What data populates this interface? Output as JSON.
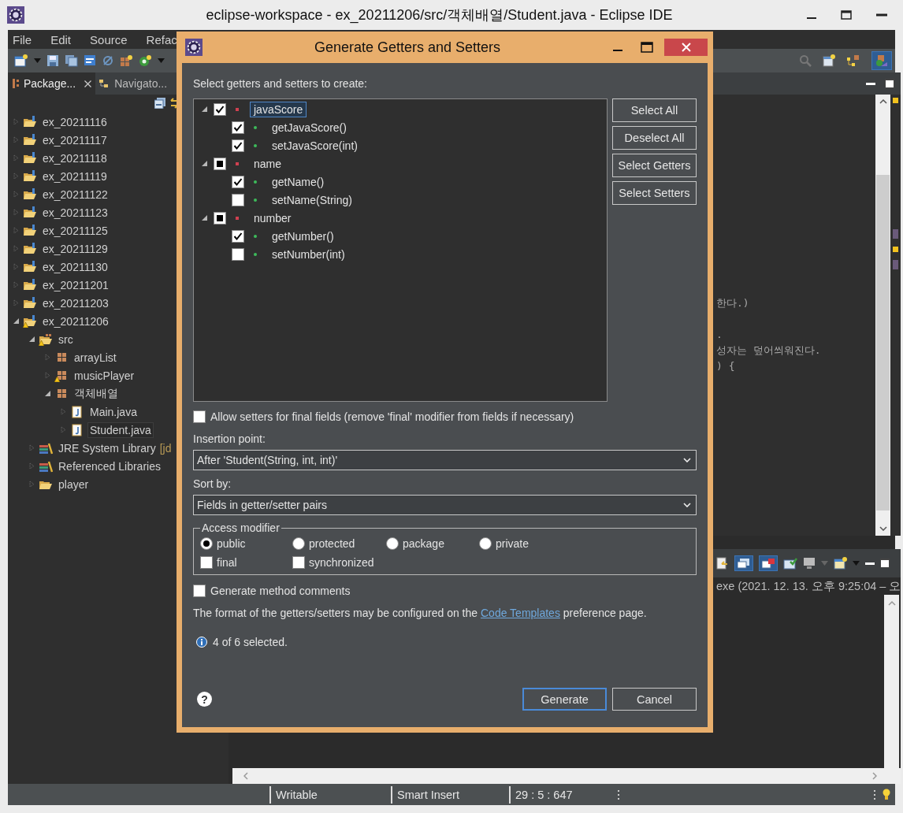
{
  "window": {
    "title": "eclipse-workspace - ex_20211206/src/객체배열/Student.java - Eclipse IDE"
  },
  "menu": [
    "File",
    "Edit",
    "Source",
    "Refac"
  ],
  "explorer": {
    "tabs": [
      {
        "label": "Package...",
        "selected": true
      },
      {
        "label": "Navigato...",
        "selected": false
      }
    ],
    "tree": [
      {
        "label": "ex_20211116",
        "kind": "project",
        "expanded": false,
        "warning": false,
        "selected": false
      },
      {
        "label": "ex_20211117",
        "kind": "project",
        "expanded": false,
        "warning": false,
        "selected": false
      },
      {
        "label": "ex_20211118",
        "kind": "project",
        "expanded": false,
        "warning": false,
        "selected": false
      },
      {
        "label": "ex_20211119",
        "kind": "project",
        "expanded": false,
        "warning": false,
        "selected": false
      },
      {
        "label": "ex_20211122",
        "kind": "project",
        "expanded": false,
        "warning": false,
        "selected": false
      },
      {
        "label": "ex_20211123",
        "kind": "project",
        "expanded": false,
        "warning": false,
        "selected": false
      },
      {
        "label": "ex_20211125",
        "kind": "project",
        "expanded": false,
        "warning": false,
        "selected": false
      },
      {
        "label": "ex_20211129",
        "kind": "project",
        "expanded": false,
        "warning": false,
        "selected": false
      },
      {
        "label": "ex_20211130",
        "kind": "project",
        "expanded": false,
        "warning": false,
        "selected": false
      },
      {
        "label": "ex_20211201",
        "kind": "project",
        "expanded": false,
        "warning": false,
        "selected": false
      },
      {
        "label": "ex_20211203",
        "kind": "project",
        "expanded": false,
        "warning": false,
        "selected": false
      },
      {
        "label": "ex_20211206",
        "kind": "project",
        "expanded": true,
        "warning": true,
        "selected": false,
        "children": [
          {
            "label": "src",
            "kind": "source-folder",
            "expanded": true,
            "warning": true,
            "selected": false,
            "children": [
              {
                "label": "arrayList",
                "kind": "package",
                "expanded": false,
                "warning": false,
                "selected": false
              },
              {
                "label": "musicPlayer",
                "kind": "package",
                "expanded": false,
                "warning": true,
                "selected": false
              },
              {
                "label": "객체배열",
                "kind": "package",
                "expanded": true,
                "warning": false,
                "selected": false,
                "children": [
                  {
                    "label": "Main.java",
                    "kind": "java-file",
                    "expanded": false,
                    "warning": false,
                    "selected": false
                  },
                  {
                    "label": "Student.java",
                    "kind": "java-file",
                    "expanded": false,
                    "warning": false,
                    "selected": true
                  }
                ]
              }
            ]
          },
          {
            "label": "JRE System Library",
            "decoration": "[jd",
            "kind": "library",
            "expanded": false,
            "warning": false,
            "selected": false
          },
          {
            "label": "Referenced Libraries",
            "kind": "library",
            "expanded": false,
            "warning": false,
            "selected": false
          },
          {
            "label": "player",
            "kind": "folder",
            "expanded": false,
            "warning": false,
            "selected": false
          }
        ]
      }
    ]
  },
  "editor": {
    "code_lines": [
      "한다.)",
      ".",
      "성자는 덮어씌워진다.",
      ") {"
    ]
  },
  "console": {
    "header": "exe  (2021. 12. 13. 오후 9:25:04 – 오"
  },
  "status_bar": [
    "Writable",
    "Smart Insert",
    "29 : 5 : 647"
  ],
  "dialog": {
    "title": "Generate Getters and Setters",
    "prompt": "Select getters and setters to create:",
    "members": [
      {
        "name": "javaScore",
        "checked": true,
        "grayed": false,
        "selected": true,
        "expanded": true,
        "methods": [
          {
            "name": "getJavaScore()",
            "checked": true
          },
          {
            "name": "setJavaScore(int)",
            "checked": true
          }
        ]
      },
      {
        "name": "name",
        "checked": true,
        "grayed": true,
        "selected": false,
        "expanded": true,
        "methods": [
          {
            "name": "getName()",
            "checked": true
          },
          {
            "name": "setName(String)",
            "checked": false
          }
        ]
      },
      {
        "name": "number",
        "checked": true,
        "grayed": true,
        "selected": false,
        "expanded": true,
        "methods": [
          {
            "name": "getNumber()",
            "checked": true
          },
          {
            "name": "setNumber(int)",
            "checked": false
          }
        ]
      }
    ],
    "side_buttons": [
      "Select All",
      "Deselect All",
      "Select Getters",
      "Select Setters"
    ],
    "allow_final": {
      "label": "Allow setters for final fields (remove 'final' modifier from fields if necessary)",
      "checked": false
    },
    "insertion_point": {
      "label": "Insertion point:",
      "value": "After 'Student(String, int, int)'"
    },
    "sort_by": {
      "label": "Sort by:",
      "value": "Fields in getter/setter pairs"
    },
    "access_modifier": {
      "title": "Access modifier",
      "options": [
        {
          "label": "public",
          "selected": true
        },
        {
          "label": "protected",
          "selected": false
        },
        {
          "label": "package",
          "selected": false
        },
        {
          "label": "private",
          "selected": false
        }
      ],
      "flags": [
        {
          "label": "final",
          "checked": false
        },
        {
          "label": "synchronized",
          "checked": false
        }
      ]
    },
    "generate_comments": {
      "label": "Generate method comments",
      "checked": false
    },
    "info": {
      "before": "The format of the getters/setters may be configured on the ",
      "link": "Code Templates",
      "after": " preference page."
    },
    "status": "4 of 6 selected.",
    "help": "?",
    "buttons": [
      {
        "label": "Generate",
        "default": true
      },
      {
        "label": "Cancel",
        "default": false
      }
    ]
  }
}
